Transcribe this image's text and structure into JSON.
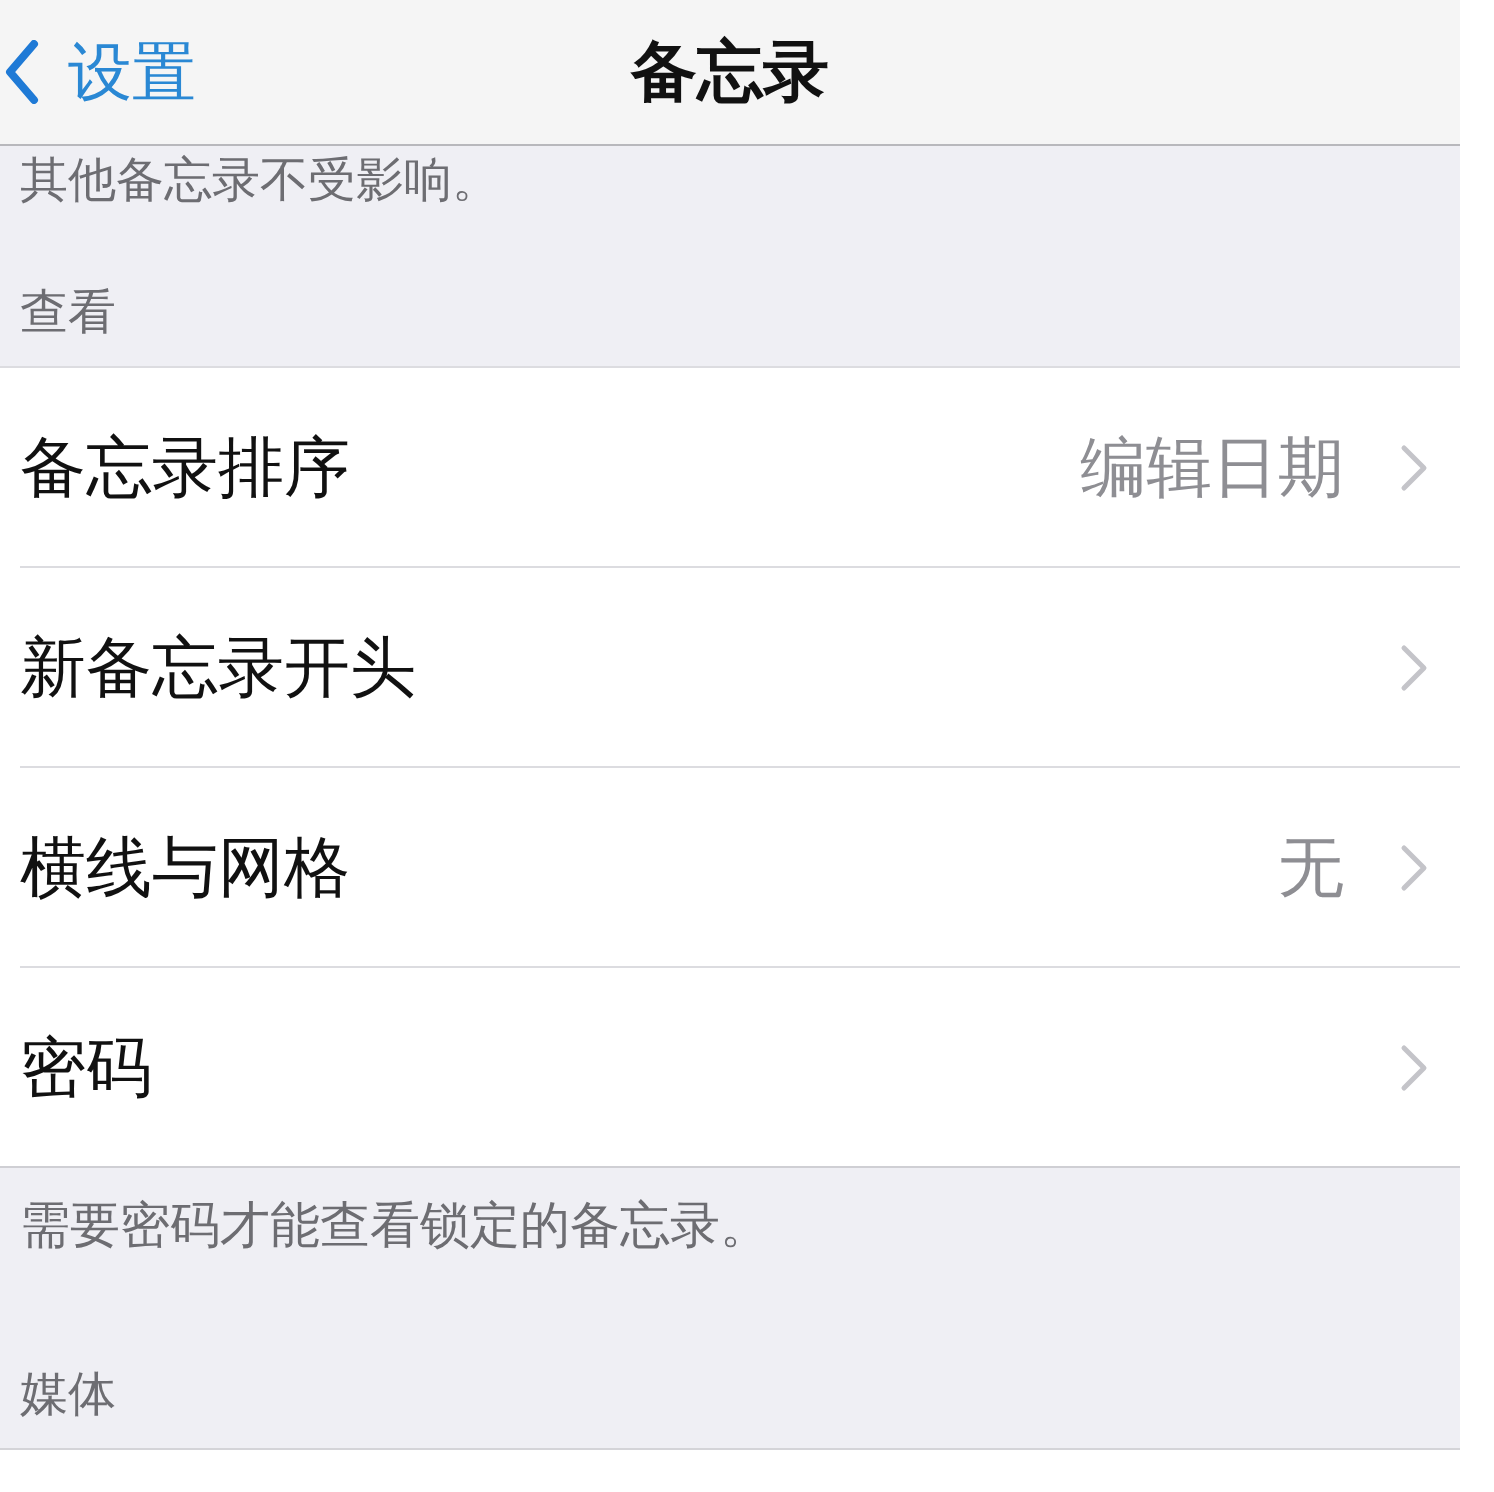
{
  "nav_bar": {
    "back_label": "设置",
    "title": "备忘录"
  },
  "previous_footer": "其他备忘录不受影响。",
  "sections": [
    {
      "header": "查看",
      "rows": [
        {
          "label": "备忘录排序",
          "value": "编辑日期"
        },
        {
          "label": "新备忘录开头"
        },
        {
          "label": "横线与网格",
          "value": "无"
        },
        {
          "label": "密码"
        }
      ],
      "footer": "需要密码才能查看锁定的备忘录。"
    },
    {
      "header": "媒体"
    }
  ]
}
